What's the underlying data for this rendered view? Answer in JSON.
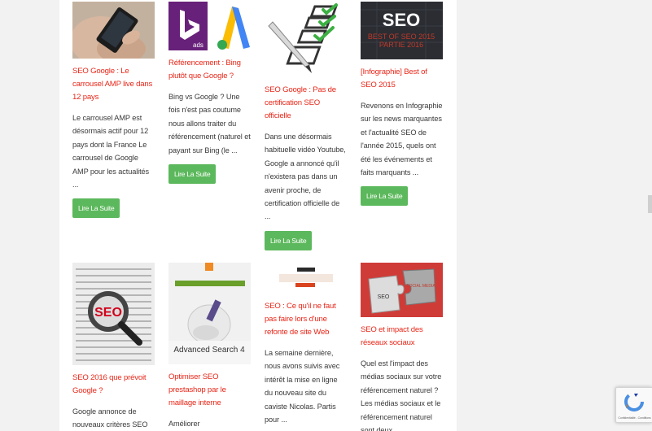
{
  "articles": [
    {
      "title": "SEO Google : Le carrousel AMP live dans 12 pays",
      "excerpt": "Le carrousel AMP est désormais actif pour 12 pays dont la France Le carrousel de Google AMP pour les actualités ...",
      "button": "Lire La Suite",
      "image": "smartphone-in-hand-photo"
    },
    {
      "title": "Référencement : Bing plutôt que Google ?",
      "excerpt": "Bing vs Google ? Une fois n'est pas coutume nous allons traiter du référencement (naturel et payant sur Bing (le ...",
      "button": "Lire La Suite",
      "image": "bing-ads-vs-adwords-logos",
      "image_text": "ads"
    },
    {
      "title": "SEO Google : Pas de certification SEO officielle",
      "excerpt": "Dans une désormais habituelle vidéo Youtube, Google a annoncé qu'il n'existera pas dans un avenir proche, de certification officielle de ...",
      "button": "Lire La Suite",
      "image": "checklist-with-pencil"
    },
    {
      "title": "[Infographie] Best of SEO 2015",
      "excerpt": "Revenons en Infographie sur les news marquantes et l'actualité SEO de l'année 2015, quels ont été les événements et faits marquants ...",
      "button": "Lire La Suite",
      "image": "seo-best-of-2015-dark-banner",
      "image_text": [
        "SEO",
        "BEST OF SEO 2015",
        "PARTIE 2016"
      ]
    },
    {
      "title": "SEO 2016 que prévoit Google ?",
      "excerpt": "Google annonce de nouveaux critères SEO",
      "image": "magnifying-glass-on-newspaper",
      "image_text": "SEO"
    },
    {
      "title": "Optimiser SEO prestashop par le maillage interne",
      "excerpt": "Améliorer",
      "image": "advanced-search-4-module-box",
      "image_text": "Advanced Search 4"
    },
    {
      "title": "SEO : Ce qu'il ne faut pas faire lors d'une refonte de site Web",
      "excerpt": "La semaine dernière, nous avons suivis avec intérêt la mise en ligne du nouveau site du caviste Nicolas. Partis pour ...",
      "image": "nicolas-website-screenshot"
    },
    {
      "title": "SEO et impact des réseaux sociaux",
      "excerpt": "Quel est l'impact des médias sociaux sur votre référencement naturel ? Les médias sociaux et le référencement naturel sont deux",
      "image": "puzzle-pieces-seo-social-media",
      "image_text": [
        "SEO",
        "SOCIAL MEDIA"
      ]
    }
  ],
  "recaptcha": {
    "label": "Confidentialité - Conditions"
  },
  "colors": {
    "title": "#e8281a",
    "button": "#5cb85c",
    "text": "#3a3a3a",
    "background": "#f2f2f2"
  }
}
